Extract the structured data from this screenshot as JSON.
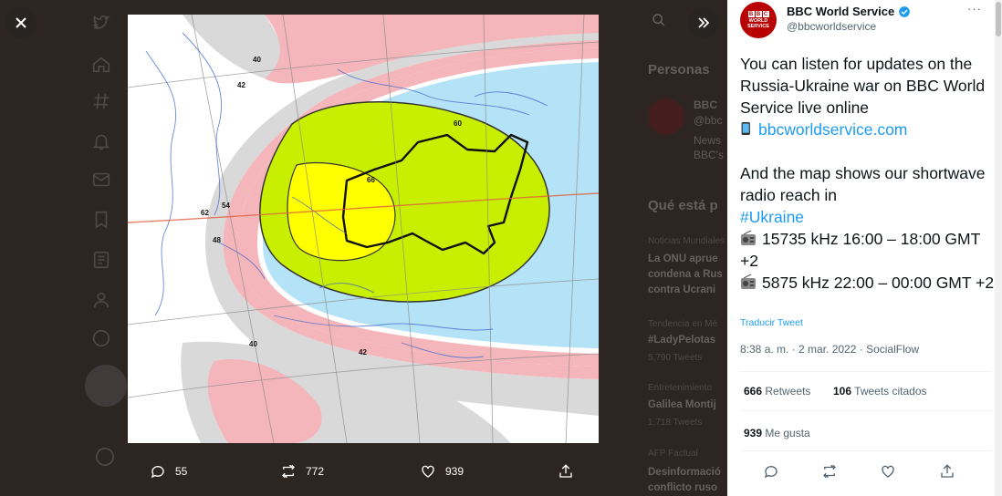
{
  "background": {
    "whos_to_follow_title": "Personas",
    "follow_item": {
      "name": "BBC",
      "handle": "@bbc",
      "desc_line1": "News",
      "desc_line2": "BBC's"
    },
    "trends_title": "Qué está p",
    "trends": [
      {
        "context": "Noticias Mundiales",
        "line1": "La ONU aprue",
        "line2": "condena a Rus",
        "line3": "contra Ucrani"
      },
      {
        "context": "Tendencia en Mé",
        "line1": "#LadyPelotas",
        "count": "5,790 Tweets"
      },
      {
        "context": "Entretenimiento",
        "line1": "Galilea Montij",
        "count": "1,718 Tweets"
      },
      {
        "context": "AFP Factual",
        "line1": "Desinformació",
        "line2": "conflicto ruso"
      }
    ],
    "search_placeholder": "Buscar"
  },
  "media_actions": {
    "replies": "55",
    "retweets": "772",
    "likes": "939"
  },
  "map": {
    "contour_labels": [
      "40",
      "42",
      "48",
      "54",
      "60",
      "66",
      "62",
      "48",
      "40",
      "40",
      "42"
    ],
    "colors": {
      "pink": "#f4b6bb",
      "grey": "#d9d9d9",
      "blue": "#b4e3f7",
      "green": "#c8ee00",
      "yellow": "#ffff00"
    }
  },
  "tweet": {
    "author_name": "BBC World Service",
    "author_handle": "@bbcworldservice",
    "avatar_letters": [
      "B",
      "B",
      "C"
    ],
    "avatar_sub1": "WORLD",
    "avatar_sub2": "SERVICE",
    "more": "···",
    "line1": "You can listen for updates on the Russia-Ukraine war on BBC World Service live online",
    "link": "bbcworldservice.com",
    "line2": "And the map shows our shortwave radio reach in",
    "hashtag": "#Ukraine",
    "freq1": "15735 kHz 16:00 – 18:00 GMT +2",
    "freq2": "5875 kHz 22:00 – 00:00 GMT +2",
    "translate": "Traducir Tweet",
    "timestamp": "8:38 a. m. · 2 mar. 2022 · SocialFlow",
    "retweets_count": "666",
    "retweets_label": "Retweets",
    "quotes_count": "106",
    "quotes_label": "Tweets citados",
    "likes_count": "939",
    "likes_label": "Me gusta"
  },
  "colors": {
    "accent": "#1d9bf0",
    "verified": "#1d9bf0",
    "bbc_red": "#b80000"
  }
}
